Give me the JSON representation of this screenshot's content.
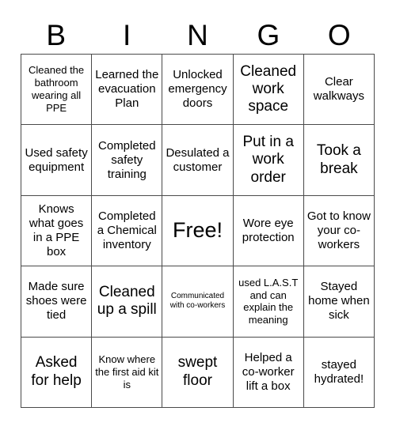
{
  "header": {
    "letters": [
      "B",
      "I",
      "N",
      "G",
      "O"
    ]
  },
  "grid": {
    "rows": 5,
    "columns": 5,
    "border_color": "#4a4a4a",
    "background_color": "#ffffff",
    "text_color": "#000000",
    "cells": [
      {
        "text": "Cleaned the bathroom wearing all PPE",
        "size": "small"
      },
      {
        "text": "Learned the evacuation Plan",
        "size": "medium"
      },
      {
        "text": "Unlocked emergency doors",
        "size": "medium"
      },
      {
        "text": "Cleaned work space",
        "size": "large"
      },
      {
        "text": "Clear walkways",
        "size": "medium"
      },
      {
        "text": "Used safety equipment",
        "size": "medium"
      },
      {
        "text": "Completed safety training",
        "size": "medium"
      },
      {
        "text": "Desulated a customer",
        "size": "medium"
      },
      {
        "text": "Put in a work order",
        "size": "large"
      },
      {
        "text": "Took a break",
        "size": "large"
      },
      {
        "text": "Knows what goes in a PPE box",
        "size": "medium"
      },
      {
        "text": "Completed a Chemical inventory",
        "size": "medium"
      },
      {
        "text": "Free!",
        "size": "free"
      },
      {
        "text": "Wore eye protection",
        "size": "medium"
      },
      {
        "text": "Got to know your co-workers",
        "size": "medium"
      },
      {
        "text": "Made sure shoes were tied",
        "size": "medium"
      },
      {
        "text": "Cleaned up a spill",
        "size": "large"
      },
      {
        "text": "Communicated with co-workers",
        "size": "xsmall"
      },
      {
        "text": "used L.A.S.T and can explain the meaning",
        "size": "small"
      },
      {
        "text": "Stayed home when sick",
        "size": "medium"
      },
      {
        "text": "Asked for help",
        "size": "large"
      },
      {
        "text": "Know where the first aid kit is",
        "size": "small"
      },
      {
        "text": "swept floor",
        "size": "large"
      },
      {
        "text": "Helped a co-worker lift a box",
        "size": "medium"
      },
      {
        "text": "stayed hydrated!",
        "size": "medium"
      }
    ]
  }
}
